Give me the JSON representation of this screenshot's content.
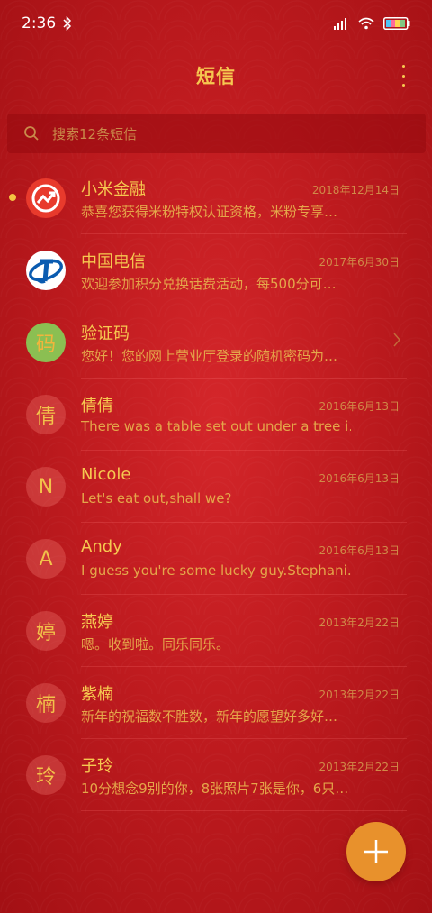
{
  "status_bar": {
    "time": "2:36",
    "icons": [
      "bluetooth-icon",
      "signal-icon",
      "wifi-icon",
      "battery-icon"
    ]
  },
  "header": {
    "title": "短信",
    "more_icon": "more-vertical-icon"
  },
  "search": {
    "placeholder": "搜索12条短信",
    "icon": "search-icon"
  },
  "colors": {
    "background": "#b5161a",
    "accent_text": "#f6c850",
    "secondary_text": "#e4a64a",
    "date_text": "#d08a48",
    "fab": "#e8912c",
    "unread_dot": "#f4c542"
  },
  "conversations": [
    {
      "avatar": "",
      "avatar_type": "xiaomi-finance-logo",
      "name": "小米金融",
      "date": "2018年12月14日",
      "preview": "恭喜您获得米粉特权认证资格，米粉专享…",
      "unread": true
    },
    {
      "avatar": "",
      "avatar_type": "china-telecom-logo",
      "name": "中国电信",
      "date": "2017年6月30日",
      "preview": "欢迎参加积分兑换话费活动，每500分可…",
      "unread": false
    },
    {
      "avatar": "码",
      "avatar_type": "letter",
      "name": "验证码",
      "date": "",
      "preview": "您好！您的网上营业厅登录的随机密码为…",
      "unread": false,
      "has_chevron": true
    },
    {
      "avatar": "倩",
      "avatar_type": "letter",
      "name": "倩倩",
      "date": "2016年6月13日",
      "preview": "There was a table set out under a tree i…",
      "unread": false
    },
    {
      "avatar": "N",
      "avatar_type": "letter",
      "name": "Nicole",
      "date": "2016年6月13日",
      "preview": "Let's eat out,shall we?",
      "unread": false
    },
    {
      "avatar": "A",
      "avatar_type": "letter",
      "name": "Andy",
      "date": "2016年6月13日",
      "preview": "I guess you're some lucky guy.Stephani…",
      "unread": false
    },
    {
      "avatar": "婷",
      "avatar_type": "letter",
      "name": "燕婷",
      "date": "2013年2月22日",
      "preview": "嗯。收到啦。同乐同乐。",
      "unread": false
    },
    {
      "avatar": "楠",
      "avatar_type": "letter",
      "name": "紫楠",
      "date": "2013年2月22日",
      "preview": "新年的祝福数不胜数，新年的愿望好多好…",
      "unread": false
    },
    {
      "avatar": "玲",
      "avatar_type": "letter",
      "name": "子玲",
      "date": "2013年2月22日",
      "preview": "10分想念9别的你，8张照片7张是你，6只…",
      "unread": false
    }
  ],
  "fab": {
    "icon": "plus-icon"
  }
}
